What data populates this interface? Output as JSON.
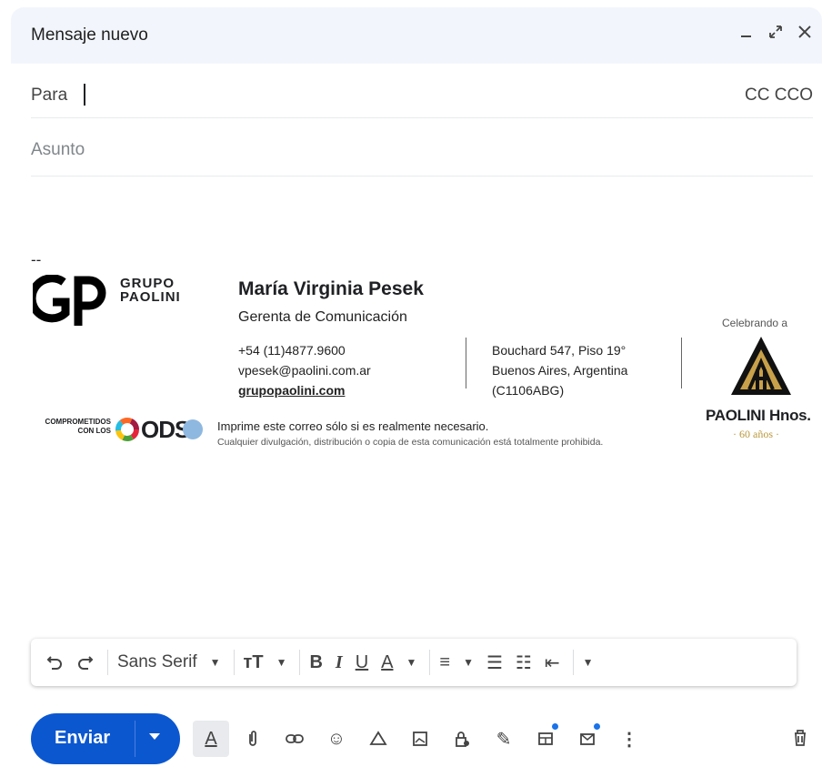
{
  "window": {
    "title": "Mensaje nuevo",
    "minimize_icon": "minimize-icon",
    "expand_icon": "expand-icon",
    "close_icon": "close-icon"
  },
  "compose": {
    "to_label": "Para",
    "cc_bcc": "CC CCO",
    "subject_placeholder": "Asunto"
  },
  "signature": {
    "separator": "--",
    "group_line1": "GRUPO",
    "group_line2": "PAOLINI",
    "name": "María Virginia Pesek",
    "role": "Gerenta de Comunicación",
    "phone": "+54 (11)4877.9600",
    "email": "vpesek@paolini.com.ar",
    "website": "grupopaolini.com",
    "address_line1": "Bouchard 547, Piso 19°",
    "address_line2": "Buenos Aires, Argentina",
    "address_line3": "(C1106ABG)",
    "celebrating": "Celebrando a",
    "company": "PAOLINI Hnos.",
    "years": "· 60 años ·",
    "ods_prefix_1": "COMPROMETIDOS",
    "ods_prefix_2": "CON LOS",
    "ods_word": "ODS",
    "print_notice": "Imprime este correo sólo si es realmente necesario.",
    "legal_notice": "Cualquier divulgación, distribución o copia de esta comunicación está totalmente prohibida."
  },
  "format_toolbar": {
    "font_family": "Sans Serif",
    "undo_icon": "undo-icon",
    "redo_icon": "redo-icon",
    "font_size_icon": "font-size-icon",
    "bold_icon": "bold-icon",
    "italic_icon": "italic-icon",
    "underline_icon": "underline-icon",
    "text_color_icon": "text-color-icon",
    "align_icon": "align-icon",
    "numbered_list_icon": "numbered-list-icon",
    "bulleted_list_icon": "bulleted-list-icon",
    "indent_less_icon": "indent-less-icon",
    "more_formatting_icon": "more-formatting-icon"
  },
  "bottom_toolbar": {
    "send_label": "Enviar",
    "icons": [
      "formatting-options-icon",
      "attach-icon",
      "link-icon",
      "emoji-icon",
      "drive-icon",
      "photo-icon",
      "confidential-icon",
      "signature-icon",
      "template-icon",
      "schedule-mail-icon",
      "more-options-icon",
      "discard-icon"
    ]
  },
  "colors": {
    "accent": "#0b57d0",
    "titlebar_bg": "#f2f6fc",
    "gold": "#b8973a"
  }
}
